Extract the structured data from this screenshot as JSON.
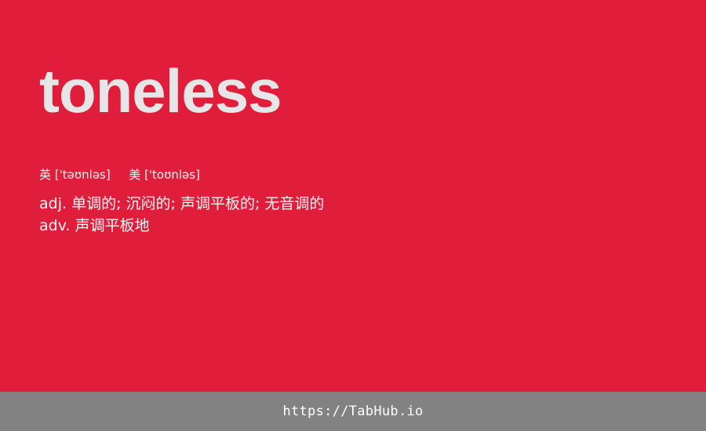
{
  "entry": {
    "word": "toneless",
    "phonetics": {
      "uk_label": "英",
      "uk_ipa": "['təʊnləs]",
      "us_label": "美",
      "us_ipa": "['toʊnləs]"
    },
    "definitions": [
      {
        "pos": "adj.",
        "meaning": "单调的; 沉闷的; 声调平板的; 无音调的"
      },
      {
        "pos": "adv.",
        "meaning": "声调平板地"
      }
    ]
  },
  "footer": {
    "url": "https://TabHub.io"
  },
  "colors": {
    "background": "#e01e3c",
    "word": "#e6e6e8",
    "footer_bar": "#828282"
  }
}
